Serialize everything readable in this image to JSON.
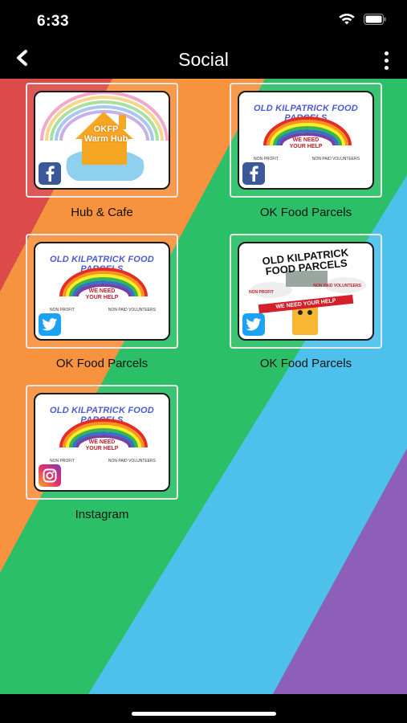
{
  "status_bar": {
    "time": "6:33",
    "icons": [
      "wifi-icon",
      "battery-icon"
    ]
  },
  "nav": {
    "title": "Social",
    "back_icon": "chevron-left-icon",
    "more_icon": "more-vertical-icon"
  },
  "colors": {
    "background": "#000000",
    "stripe_red": "#dc4a4a",
    "stripe_orange": "#f7923f",
    "stripe_green": "#2bbf68",
    "stripe_blue": "#4dc1ec",
    "stripe_purple": "#8e5fb8",
    "facebook": "#3b5998",
    "twitter": "#1da1f2"
  },
  "tiles": [
    {
      "label": "Hub & Cafe",
      "network": "facebook",
      "badge_icon": "facebook-icon",
      "art": {
        "title": "OKFP Warm Hub"
      }
    },
    {
      "label": "OK Food Parcels",
      "network": "facebook",
      "badge_icon": "facebook-icon",
      "art": {
        "title": "OLD KILPATRICK FOOD PARCELS",
        "need_1": "WE NEED",
        "need_2": "YOUR HELP",
        "left": "NON PROFIT",
        "right": "NON PAID VOLUNTEERS"
      }
    },
    {
      "label": "OK Food Parcels",
      "network": "twitter",
      "badge_icon": "twitter-icon",
      "art": {
        "title": "OLD KILPATRICK FOOD PARCELS",
        "need_1": "WE NEED",
        "need_2": "YOUR HELP",
        "left": "NON PROFIT",
        "right": "NON PAID VOLUNTEERS"
      }
    },
    {
      "label": "OK Food Parcels",
      "network": "twitter",
      "badge_icon": "twitter-icon",
      "art": {
        "title_1": "OLD KILPATRICK",
        "title_2": "FOOD PARCELS",
        "need": "WE NEED YOUR HELP",
        "left": "NON PROFIT",
        "right": "NON PAID VOLUNTEERS"
      }
    },
    {
      "label": "Instagram",
      "network": "instagram",
      "badge_icon": "instagram-icon",
      "art": {
        "title": "OLD KILPATRICK FOOD PARCELS",
        "need_1": "WE NEED",
        "need_2": "YOUR HELP",
        "left": "NON PROFIT",
        "right": "NON PAID VOLUNTEERS"
      }
    }
  ]
}
